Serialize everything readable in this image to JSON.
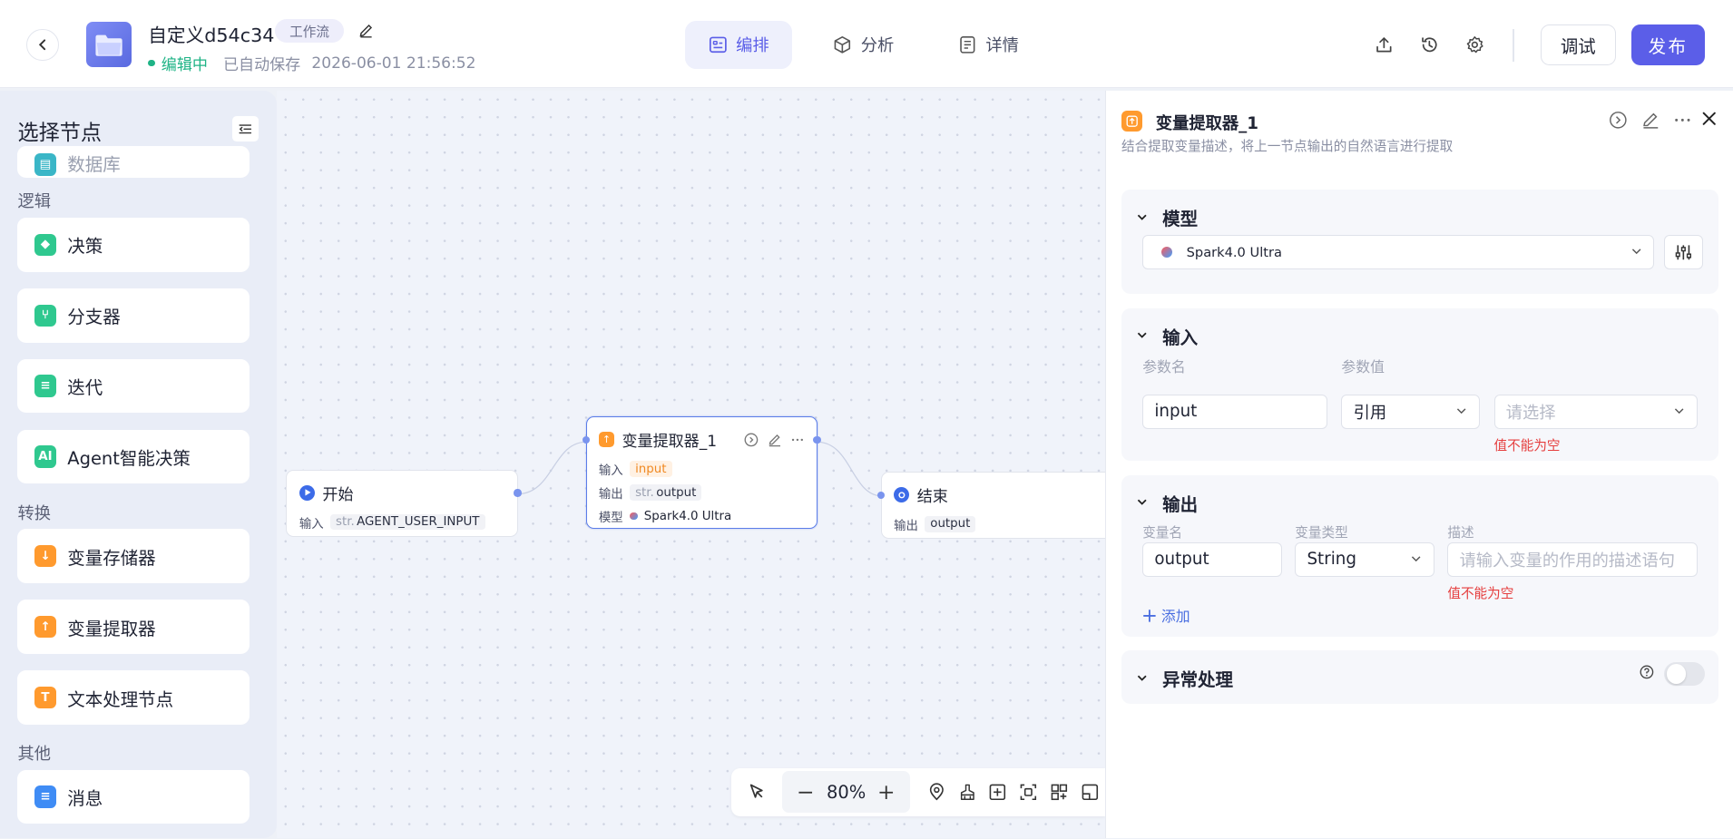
{
  "header": {
    "title": "自定义d54c34",
    "type_badge": "工作流",
    "status_editing": "编辑中",
    "status_saved": "已自动保存",
    "status_time": "2026-06-01 21:56:52",
    "tabs": [
      {
        "label": "编排",
        "active": true
      },
      {
        "label": "分析",
        "active": false
      },
      {
        "label": "详情",
        "active": false
      }
    ],
    "debug_label": "调试",
    "publish_label": "发布"
  },
  "left_panel": {
    "title": "选择节点",
    "partial_item": "数据库",
    "groups": [
      {
        "name": "逻辑",
        "items": [
          "决策",
          "分支器",
          "迭代",
          "Agent智能决策"
        ]
      },
      {
        "name": "转换",
        "items": [
          "变量存储器",
          "变量提取器",
          "文本处理节点"
        ]
      },
      {
        "name": "其他",
        "items": [
          "消息"
        ]
      }
    ]
  },
  "canvas": {
    "start_node": {
      "title": "开始",
      "input_key": "输入",
      "input_type": "str.",
      "input_value": "AGENT_USER_INPUT"
    },
    "extractor_node": {
      "title": "变量提取器_1",
      "input_key": "输入",
      "input_value": "input",
      "output_key": "输出",
      "output_type": "str.",
      "output_value": "output",
      "model_key": "模型",
      "model_value": "Spark4.0 Ultra"
    },
    "end_node": {
      "title": "结束",
      "output_key": "输出",
      "output_value": "output"
    },
    "zoom": "80%"
  },
  "right_panel": {
    "title": "变量提取器_1",
    "description": "结合提取变量描述，将上一节点输出的自然语言进行提取",
    "model_section": {
      "title": "模型",
      "model_name": "Spark4.0 Ultra"
    },
    "input_section": {
      "title": "输入",
      "param_name_label": "参数名",
      "param_value_label": "参数值",
      "param_name": "input",
      "ref_type": "引用",
      "select_placeholder": "请选择",
      "error": "值不能为空"
    },
    "output_section": {
      "title": "输出",
      "var_name_label": "变量名",
      "var_type_label": "变量类型",
      "desc_label": "描述",
      "var_name": "output",
      "var_type": "String",
      "desc_placeholder": "请输入变量的作用的描述语句",
      "error": "值不能为空",
      "add_label": "添加"
    },
    "exception_section": {
      "title": "异常处理",
      "enabled": false
    }
  },
  "colors": {
    "accent": "#5b5ee8",
    "success": "#1fb386",
    "error": "#e53e3e",
    "node_orange": "#ff9a2e"
  }
}
